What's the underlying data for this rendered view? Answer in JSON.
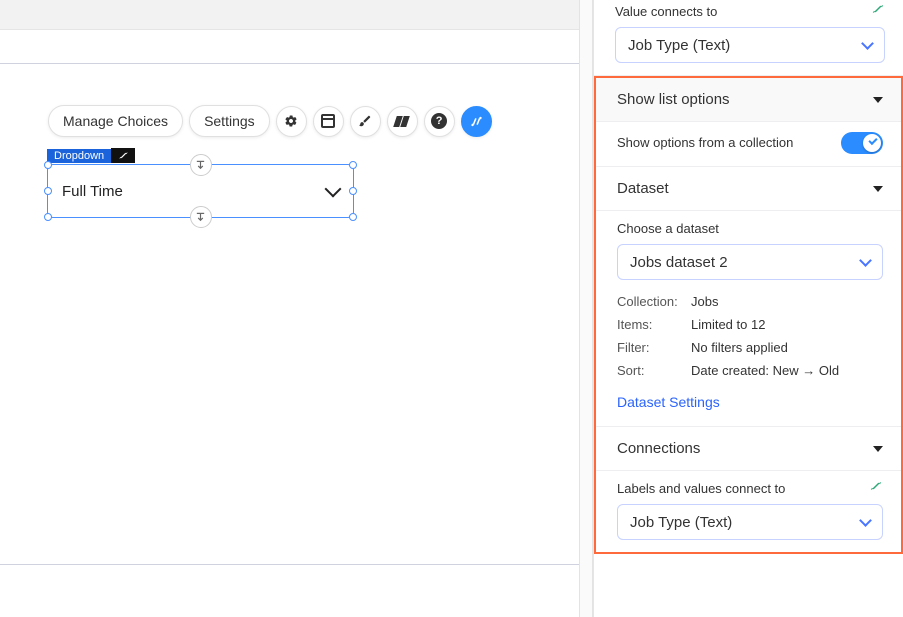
{
  "canvas": {
    "toolbar": {
      "manage_choices": "Manage Choices",
      "settings": "Settings"
    },
    "element": {
      "tag": "Dropdown",
      "value": "Full Time"
    }
  },
  "panel": {
    "value_connects": {
      "label": "Value connects to",
      "value": "Job Type (Text)"
    },
    "show_list_options": {
      "title": "Show list options",
      "toggle_label": "Show options from a collection",
      "toggle_on": true
    },
    "dataset": {
      "title": "Dataset",
      "choose_label": "Choose a dataset",
      "value": "Jobs dataset 2",
      "collection_key": "Collection:",
      "collection_val": "Jobs",
      "items_key": "Items:",
      "items_val": "Limited to 12",
      "filter_key": "Filter:",
      "filter_val": "No filters applied",
      "sort_key": "Sort:",
      "sort_val": "Date created: New → Old",
      "settings_link": "Dataset Settings"
    },
    "connections": {
      "title": "Connections",
      "labels_values": "Labels and values connect to",
      "value": "Job Type (Text)"
    }
  }
}
